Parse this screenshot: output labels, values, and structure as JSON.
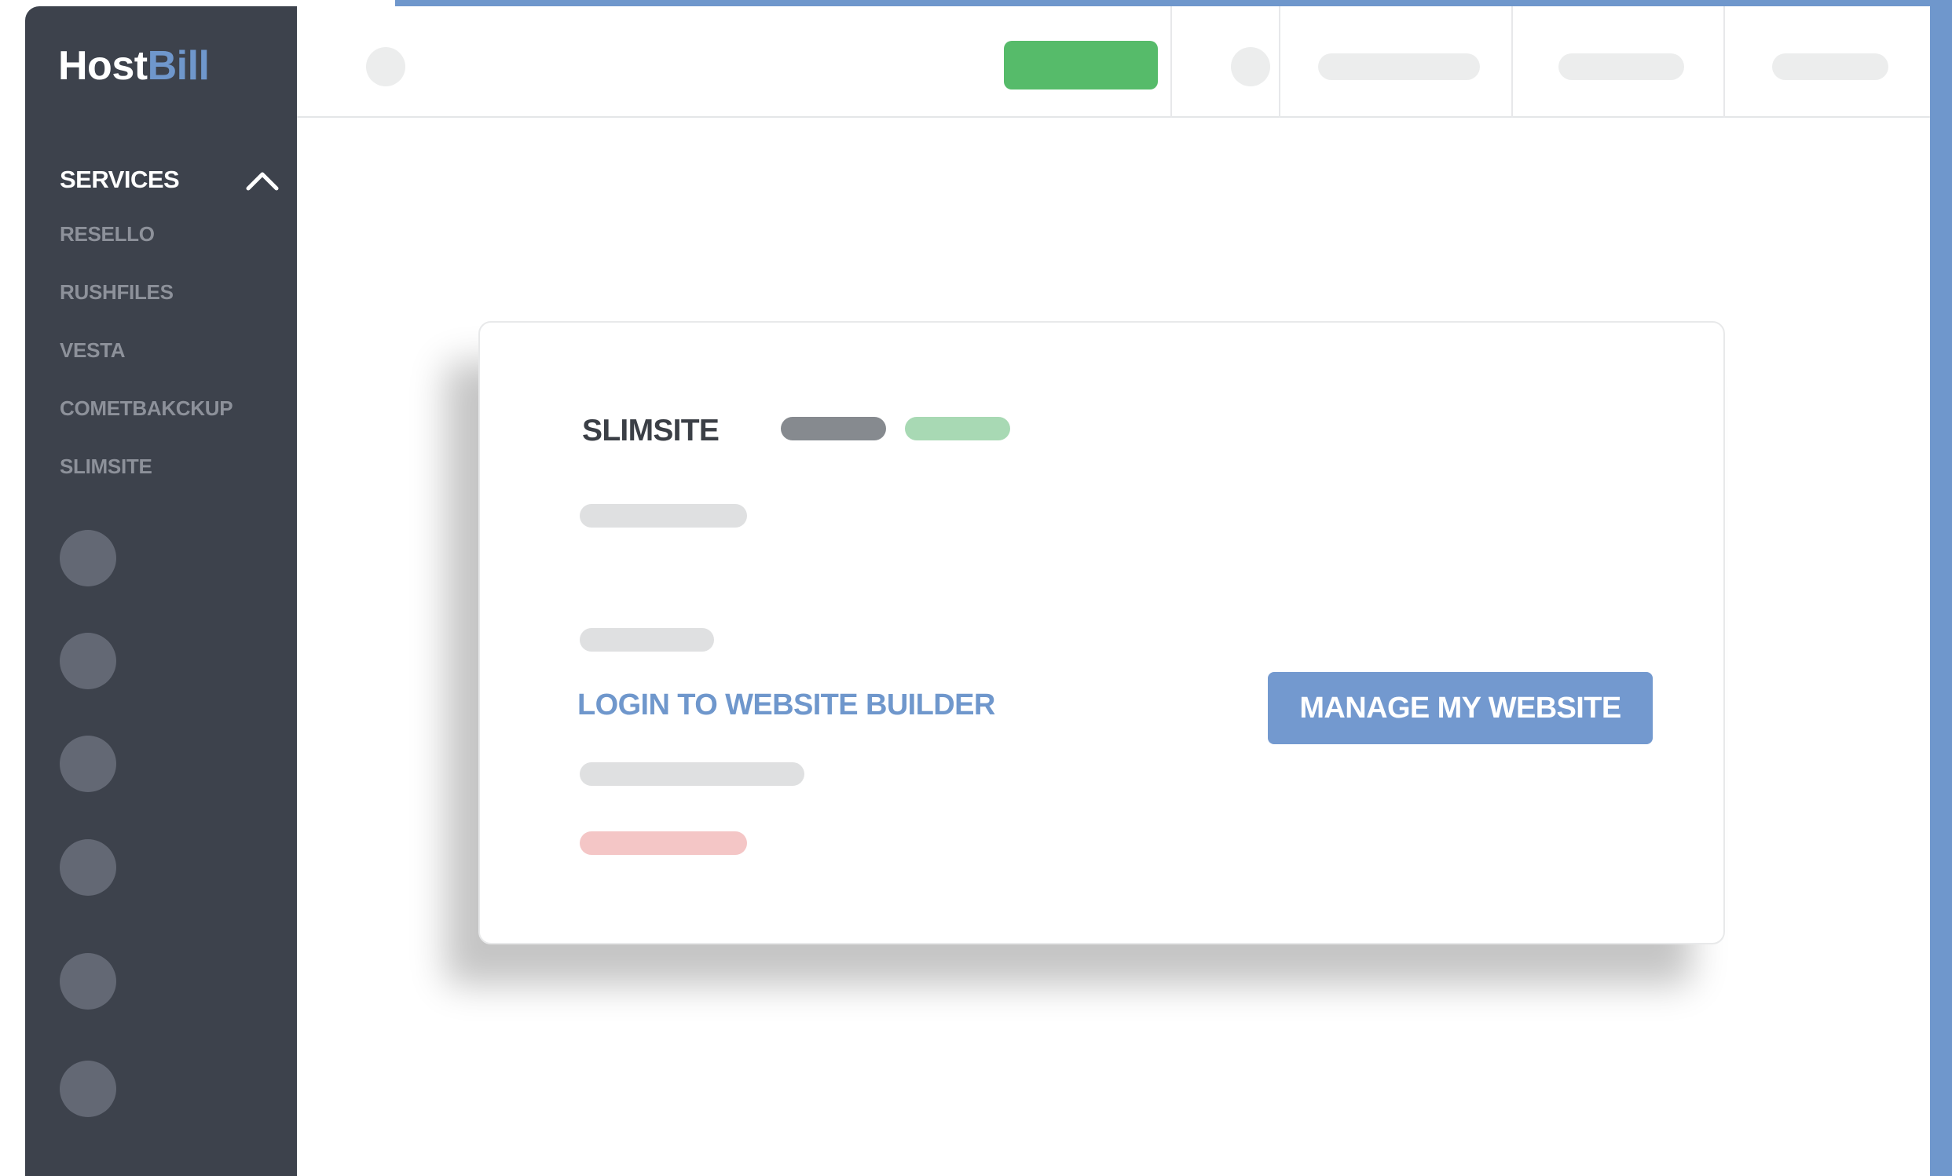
{
  "app": {
    "logo_part1": "Host",
    "logo_part2": "Bill"
  },
  "sidebar": {
    "section_label": "SERVICES",
    "section_icon": "chevron-up-icon",
    "items": [
      {
        "label": "RESELLO"
      },
      {
        "label": "RUSHFILES"
      },
      {
        "label": "VESTA"
      },
      {
        "label": "COMETBAKCKUP"
      },
      {
        "label": "SLIMSITE"
      }
    ]
  },
  "card": {
    "title": "SLIMSITE",
    "login_link": "LOGIN TO WEBSITE BUILDER",
    "manage_button": "MANAGE MY WEBSITE"
  },
  "colors": {
    "sidebar_bg": "#3d424c",
    "accent_blue": "#6f97cc",
    "green": "#56bb6a",
    "status_gray": "#868a8f",
    "status_green": "#a8d9b4",
    "placeholder_gray": "#dfe0e1",
    "placeholder_red": "#f4c6c6"
  }
}
